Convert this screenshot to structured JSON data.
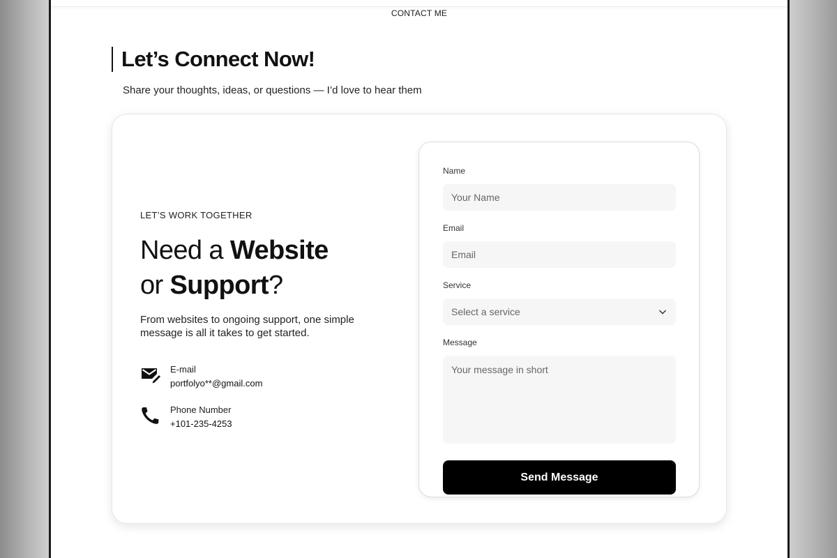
{
  "nav": {
    "section_label": "CONTACT ME"
  },
  "header": {
    "title": "Let’s Connect Now!",
    "subtitle": "Share your thoughts, ideas, or questions — I’d love to hear them"
  },
  "pitch": {
    "eyebrow": "LET’S WORK TOGETHER",
    "headline_part1": "Need a ",
    "headline_bold1": "Website",
    "headline_part2": "or ",
    "headline_bold2": "Support",
    "headline_part3": "?",
    "description": "From websites to ongoing support, one simple message is all it takes to get started."
  },
  "contacts": {
    "email": {
      "title": "E-mail",
      "value": "portfolyo**@gmail.com",
      "icon": "mail-edit-icon"
    },
    "phone": {
      "title": "Phone Number",
      "value": "+101-235-4253",
      "icon": "phone-icon"
    }
  },
  "form": {
    "name": {
      "label": "Name",
      "placeholder": "Your Name"
    },
    "email": {
      "label": "Email",
      "placeholder": "Email"
    },
    "service": {
      "label": "Service",
      "selected": "Select a service"
    },
    "message": {
      "label": "Message",
      "placeholder": "Your message in short"
    },
    "submit_label": "Send Message"
  },
  "colors": {
    "primary_button": "#000000",
    "input_bg": "#f6f6f6"
  }
}
